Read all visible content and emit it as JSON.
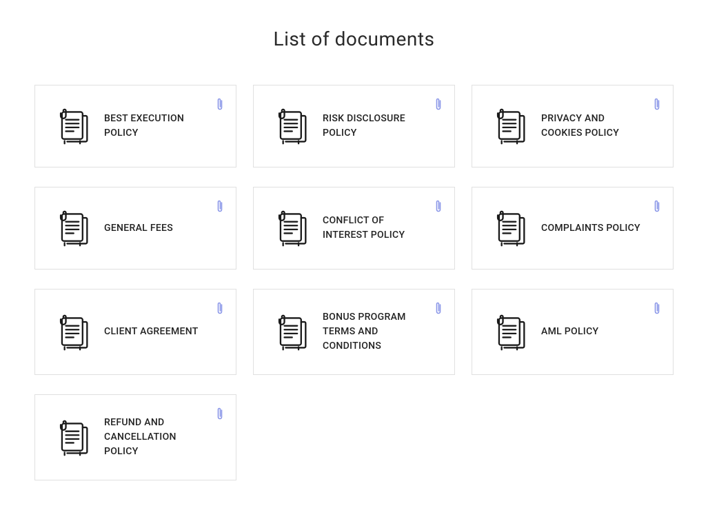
{
  "page": {
    "title": "List of documents"
  },
  "documents": [
    {
      "title": "BEST EXECUTION POLICY"
    },
    {
      "title": "RISK DISCLOSURE POLICY"
    },
    {
      "title": "PRIVACY AND COOKIES POLICY"
    },
    {
      "title": "GENERAL FEES"
    },
    {
      "title": "CONFLICT OF INTEREST POLICY"
    },
    {
      "title": "COMPLAINTS POLICY"
    },
    {
      "title": "CLIENT AGREEMENT"
    },
    {
      "title": "BONUS PROGRAM TERMS AND CONDITIONS"
    },
    {
      "title": "AML POLICY"
    },
    {
      "title": "REFUND AND CANCELLATION POLICY"
    }
  ]
}
